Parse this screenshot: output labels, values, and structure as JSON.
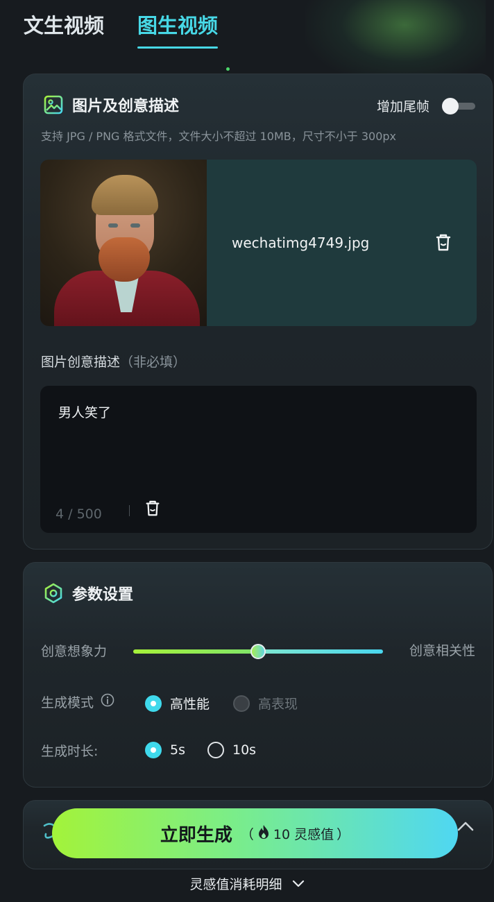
{
  "tabs": [
    {
      "label": "文生视频",
      "active": false
    },
    {
      "label": "图生视频",
      "active": true
    }
  ],
  "image_section": {
    "title": "图片及创意描述",
    "tail_frame_label": "增加尾帧",
    "tail_frame_enabled": false,
    "hint": "支持 JPG / PNG 格式文件，文件大小不超过 10MB，尺寸不小于 300px",
    "filename": "wechatimg4749.jpg"
  },
  "description": {
    "label": "图片创意描述",
    "optional": "（非必填）",
    "value": "男人笑了",
    "counter": "4 / 500"
  },
  "params": {
    "title": "参数设置",
    "slider_left_label": "创意想象力",
    "slider_right_label": "创意相关性",
    "slider_value": 0.5,
    "mode_label": "生成模式",
    "mode_options": [
      {
        "label": "高性能",
        "selected": true,
        "disabled": false
      },
      {
        "label": "高表现",
        "selected": false,
        "disabled": true
      }
    ],
    "duration_label": "生成时长:",
    "duration_options": [
      {
        "label": "5s",
        "selected": true
      },
      {
        "label": "10s",
        "selected": false
      }
    ]
  },
  "generate": {
    "label": "立即生成",
    "cost_open": "（",
    "cost": "10 灵感值",
    "cost_close": "）"
  },
  "detail_link": "灵感值消耗明细",
  "colors": {
    "accent": "#47d8e6",
    "gradient_start": "#a3f33a",
    "gradient_end": "#4fd7f2",
    "background": "#171b1f"
  }
}
